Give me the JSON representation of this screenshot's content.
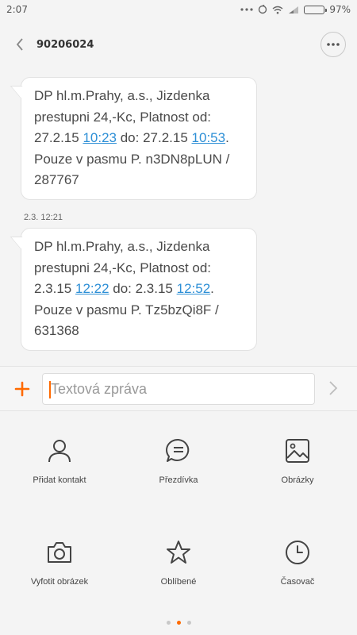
{
  "status": {
    "time": "2:07",
    "battery": "97%",
    "battery_level": 0.97
  },
  "header": {
    "title": "90206024"
  },
  "messages": [
    {
      "parts": [
        "DP hl.m.Prahy, a.s., Jizdenka prestupni 24,-Kc, Platnost od: 27.2.15 ",
        "10:23",
        " do: 27.2.15 ",
        "10:53",
        ". Pouze v pasmu P. n3DN8pLUN / 287767"
      ]
    },
    {
      "timestamp": "2.3. 12:21",
      "parts": [
        "DP hl.m.Prahy, a.s., Jizdenka prestupni 24,-Kc, Platnost od: 2.3.15 ",
        "12:22",
        " do: 2.3.15 ",
        "12:52",
        ". Pouze v pasmu P. Tz5bzQi8F / 631368"
      ]
    }
  ],
  "composer": {
    "placeholder": "Textová zpráva"
  },
  "attachments": [
    {
      "icon": "person-icon",
      "label": "Přidat kontakt"
    },
    {
      "icon": "chat-bubble-icon",
      "label": "Přezdívka"
    },
    {
      "icon": "image-icon",
      "label": "Obrázky"
    },
    {
      "icon": "camera-icon",
      "label": "Vyfotit obrázek"
    },
    {
      "icon": "star-icon",
      "label": "Oblíbené"
    },
    {
      "icon": "clock-icon",
      "label": "Časovač"
    }
  ],
  "pager": {
    "pages": 3,
    "current": 2
  },
  "colors": {
    "accent": "#ff6a00",
    "link": "#2d8fd6"
  }
}
